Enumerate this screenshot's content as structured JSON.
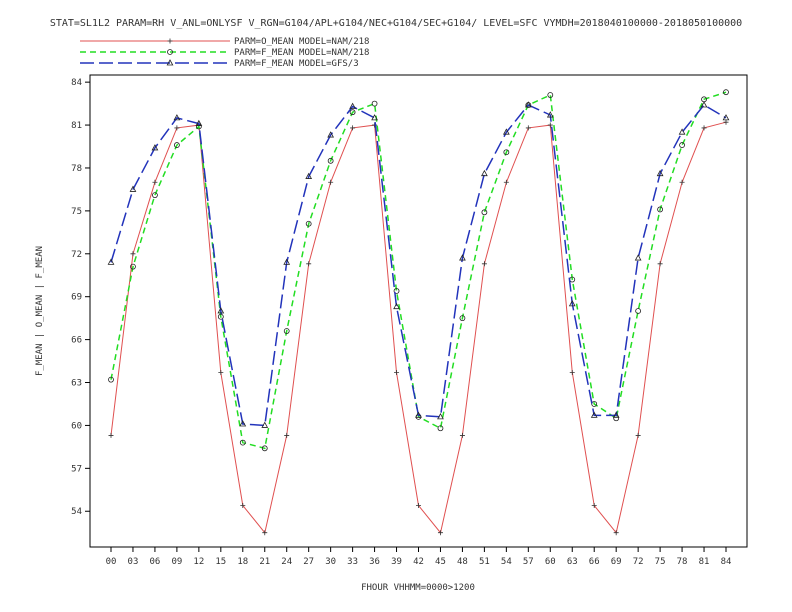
{
  "header": {
    "title": "STAT=SL1L2 PARAM=RH V_ANL=ONLYSF V_RGN=G104/APL+G104/NEC+G104/SEC+G104/ LEVEL=SFC VYMDH=2018040100000-2018050100000"
  },
  "chart_data": {
    "type": "line",
    "title": "STAT=SL1L2 PARAM=RH V_ANL=ONLYSF V_RGN=G104/APL+G104/NEC+G104/SEC+G104/ LEVEL=SFC VYMDH=2018040100000-2018050100000",
    "xlabel": "FHOUR VHHMM=0000>1200",
    "ylabel": "F_MEAN | O_MEAN | F_MEAN",
    "categories": [
      "00",
      "03",
      "06",
      "09",
      "12",
      "15",
      "18",
      "21",
      "24",
      "27",
      "30",
      "33",
      "36",
      "39",
      "42",
      "45",
      "48",
      "51",
      "54",
      "57",
      "60",
      "63",
      "66",
      "69",
      "72",
      "75",
      "78",
      "81",
      "84"
    ],
    "ylim": [
      51.5,
      84.5
    ],
    "yticks": [
      54,
      57,
      60,
      63,
      66,
      69,
      72,
      75,
      78,
      81,
      84
    ],
    "grid": false,
    "legend_position": "top-left",
    "series": [
      {
        "name": "PARM=O_MEAN MODEL=NAM/218",
        "color": "#e05050",
        "dash": "solid",
        "marker": "+",
        "values": [
          59.3,
          72.0,
          77.0,
          80.8,
          81.0,
          63.7,
          54.4,
          52.5,
          59.3,
          71.3,
          77.0,
          80.8,
          81.0,
          63.7,
          54.4,
          52.5,
          59.3,
          71.3,
          77.0,
          80.8,
          81.0,
          63.7,
          54.4,
          52.5,
          59.3,
          71.3,
          77.0,
          80.8,
          81.2
        ]
      },
      {
        "name": "PARM=F_MEAN MODEL=NAM/218",
        "color": "#22dd22",
        "dash": "dashed",
        "marker": "o",
        "values": [
          63.2,
          71.1,
          76.1,
          79.6,
          80.9,
          67.6,
          58.8,
          58.4,
          66.6,
          74.1,
          78.5,
          81.9,
          82.5,
          69.4,
          60.6,
          59.8,
          67.5,
          74.9,
          79.1,
          82.4,
          83.1,
          70.2,
          61.5,
          60.5,
          68.0,
          75.1,
          79.6,
          82.8,
          83.3
        ]
      },
      {
        "name": "PARM=F_MEAN MODEL=GFS/3",
        "color": "#2233bb",
        "dash": "longdash",
        "marker": "triangle",
        "values": [
          71.4,
          76.5,
          79.4,
          81.5,
          81.1,
          68.0,
          60.1,
          60.0,
          71.4,
          77.4,
          80.3,
          82.3,
          81.5,
          68.3,
          60.7,
          60.6,
          71.7,
          77.6,
          80.5,
          82.4,
          81.7,
          68.5,
          60.7,
          60.7,
          71.7,
          77.6,
          80.5,
          82.4,
          81.5
        ]
      }
    ]
  }
}
